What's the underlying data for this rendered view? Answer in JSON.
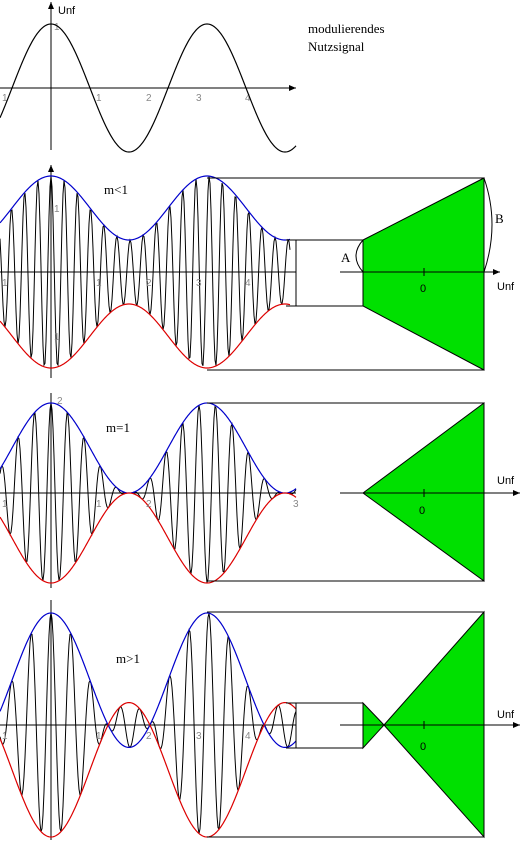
{
  "colors": {
    "signal": "#000000",
    "envelope_upper": "#0000cc",
    "envelope_lower": "#dd0000",
    "trapezoid_fill": "#00e000",
    "axis": "#000000",
    "guide": "#000000"
  },
  "top_panel": {
    "y_axis_label": "Unf",
    "caption_line1": "modulierendes",
    "caption_line2": "Nutzsignal",
    "x_ticks": [
      "1",
      "1",
      "2",
      "3",
      "4"
    ],
    "y_tick": "1"
  },
  "panels": [
    {
      "id": "m-lt-1",
      "label": "m<1",
      "y_tick_top": "1",
      "y_tick_bottom": "1",
      "x_ticks": [
        "1",
        "1",
        "2",
        "3",
        "4"
      ],
      "trap_axis_label": "Unf",
      "trap_zero_label": "0",
      "trap_marker_a": "A",
      "trap_marker_b": "B"
    },
    {
      "id": "m-eq-1",
      "label": "m=1",
      "y_tick_top": "2",
      "x_ticks": [
        "1",
        "1",
        "2",
        "3"
      ],
      "trap_axis_label": "Unf",
      "trap_zero_label": "0"
    },
    {
      "id": "m-gt-1",
      "label": "m>1",
      "x_ticks": [
        "1",
        "1",
        "2",
        "3",
        "4"
      ],
      "trap_axis_label": "Unf",
      "trap_zero_label": "0"
    }
  ]
}
